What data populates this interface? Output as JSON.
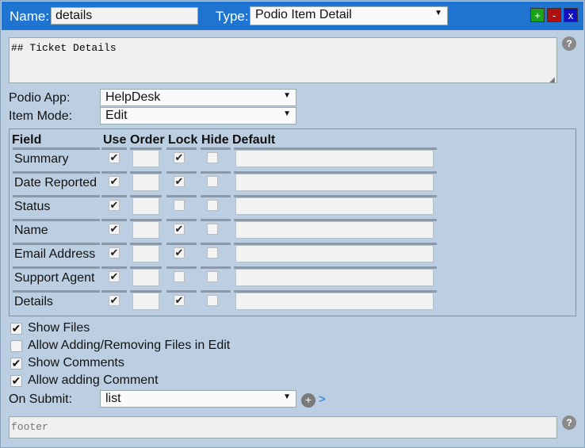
{
  "header": {
    "name_label": "Name:",
    "name_value": "details",
    "type_label": "Type:",
    "type_value": "Podio Item Detail",
    "add_label": "+",
    "remove_label": "-",
    "close_label": "x",
    "colors": {
      "bar": "#1e74d0",
      "add": "#1aa31a",
      "remove": "#b01010",
      "close": "#1010c0"
    }
  },
  "header_text": "## Ticket Details",
  "help_label": "?",
  "podio_app": {
    "label": "Podio App:",
    "value": "HelpDesk"
  },
  "item_mode": {
    "label": "Item Mode:",
    "value": "Edit"
  },
  "fields_table": {
    "columns": [
      "Field",
      "Use",
      "Order",
      "Lock",
      "Hide",
      "Default"
    ],
    "rows": [
      {
        "field": "Summary",
        "use": true,
        "lock": true,
        "hide": false
      },
      {
        "field": "Date Reported",
        "use": true,
        "lock": true,
        "hide": false
      },
      {
        "field": "Status",
        "use": true,
        "lock": false,
        "hide": false
      },
      {
        "field": "Name",
        "use": true,
        "lock": true,
        "hide": false
      },
      {
        "field": "Email Address",
        "use": true,
        "lock": true,
        "hide": false
      },
      {
        "field": "Support Agent",
        "use": true,
        "lock": false,
        "hide": false
      },
      {
        "field": "Details",
        "use": true,
        "lock": true,
        "hide": false
      }
    ]
  },
  "options": [
    {
      "label": "Show Files",
      "checked": true
    },
    {
      "label": "Allow Adding/Removing Files in Edit",
      "checked": false
    },
    {
      "label": "Show Comments",
      "checked": true
    },
    {
      "label": "Allow adding Comment",
      "checked": true
    }
  ],
  "on_submit": {
    "label": "On Submit:",
    "value": "list",
    "add_label": "+",
    "go_label": ">"
  },
  "footer_placeholder": "footer"
}
